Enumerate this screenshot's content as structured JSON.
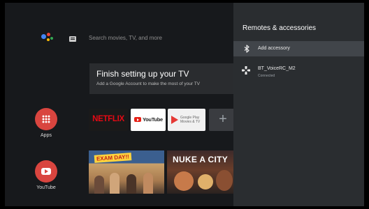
{
  "home": {
    "search_placeholder": "Search movies, TV, and more",
    "setup_card": {
      "title": "Finish setting up your TV",
      "subtitle": "Add a Google Account to make the most of your TV"
    },
    "rail": [
      {
        "label": "Apps",
        "icon": "apps-grid-icon"
      },
      {
        "label": "YouTube",
        "icon": "youtube-icon"
      }
    ],
    "app_tiles": [
      {
        "name": "NETFLIX",
        "color": "#e50914"
      },
      {
        "name": "YouTube",
        "color": "#e62117"
      },
      {
        "name": "Google Play Movies & TV",
        "color": "#e53935"
      },
      {
        "name": "+"
      }
    ],
    "thumbnails": [
      {
        "text": "EXAM DAY!!"
      },
      {
        "text": "NUKE A CITY"
      }
    ]
  },
  "panel": {
    "title": "Remotes & accessories",
    "add_accessory": "Add accessory",
    "device": {
      "name": "BT_VoiceRC_M2",
      "status": "Connected"
    }
  },
  "colors": {
    "background": "#17191c",
    "panel": "#2a2d30",
    "selected_row": "#41454a",
    "accent_red": "#d9453f"
  }
}
